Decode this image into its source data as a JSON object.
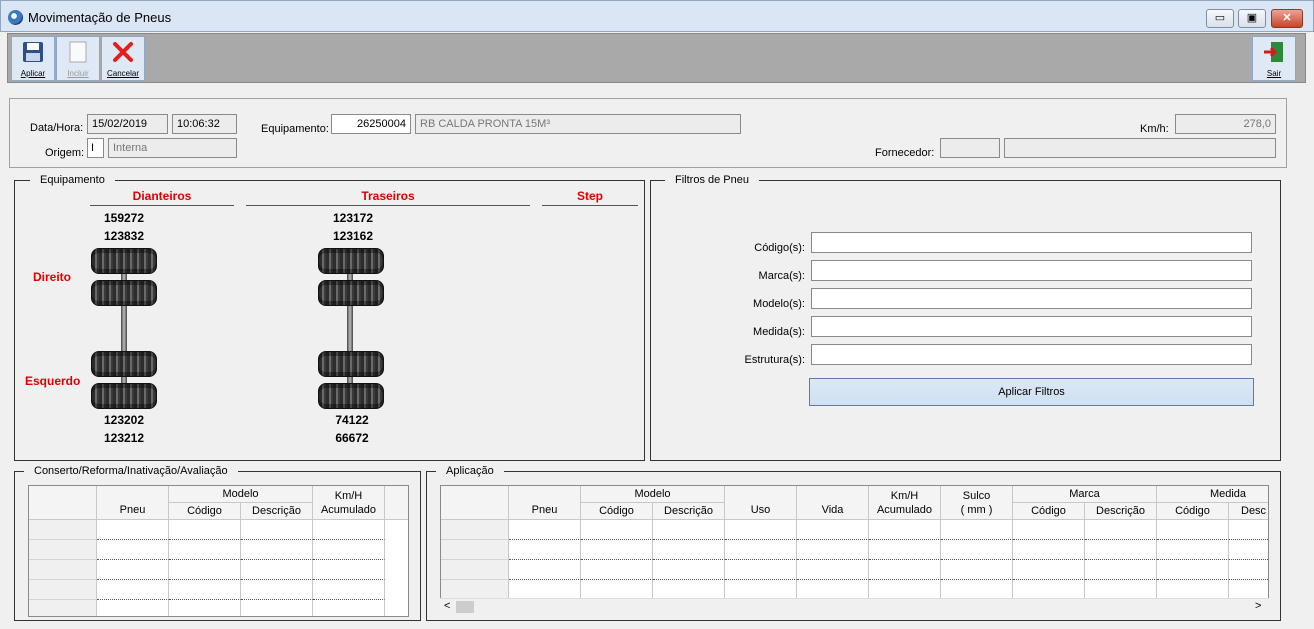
{
  "window": {
    "title": "Movimentação de Pneus",
    "btn_min": "▭",
    "btn_max": "▣",
    "btn_close": "✕"
  },
  "toolbar": {
    "apply": "Aplicar",
    "include": "Incluir",
    "cancel": "Cancelar",
    "exit": "Sair"
  },
  "header": {
    "datahora_label": "Data/Hora:",
    "date": "15/02/2019",
    "time": "10:06:32",
    "origem_label": "Origem:",
    "origem_code": "I",
    "origem_value": "Interna",
    "equip_label": "Equipamento:",
    "equip_code": "26250004",
    "equip_desc": "RB CALDA PRONTA 15M³",
    "kmh_label": "Km/h:",
    "kmh_value": "278,0",
    "fornecedor_label": "Fornecedor:"
  },
  "equip": {
    "title": "Equipamento",
    "dianteiros": "Dianteiros",
    "traseiros": "Traseiros",
    "step": "Step",
    "direito": "Direito",
    "esquerdo": "Esquerdo",
    "front_top1": "159272",
    "front_top2": "123832",
    "rear_top1": "123172",
    "rear_top2": "123162",
    "front_bot1": "123202",
    "front_bot2": "123212",
    "rear_bot1": "74122",
    "rear_bot2": "66672"
  },
  "filters": {
    "title": "Filtros de Pneu",
    "codigo": "Código(s):",
    "marca": "Marca(s):",
    "modelo": "Modelo(s):",
    "medida": "Medida(s):",
    "estrutura": "Estrutura(s):",
    "apply": "Aplicar Filtros"
  },
  "conserto": {
    "title": "Conserto/Reforma/Inativação/Avaliação",
    "pneu": "Pneu",
    "modelo": "Modelo",
    "codigo": "Código",
    "descricao": "Descrição",
    "kmh1": "Km/H",
    "kmh2": "Acumulado"
  },
  "aplicacao": {
    "title": "Aplicação",
    "pneu": "Pneu",
    "modelo": "Modelo",
    "codigo": "Código",
    "descricao": "Descrição",
    "uso": "Uso",
    "vida": "Vida",
    "kmh1": "Km/H",
    "kmh2": "Acumulado",
    "sulco1": "Sulco",
    "sulco2": "( mm )",
    "marca": "Marca",
    "marca_codigo": "Código",
    "marca_descricao": "Descrição",
    "medida": "Medida",
    "medida_codigo": "Código",
    "medida_descricao": "Desc",
    "scroll_left": "<",
    "scroll_right": ">"
  }
}
